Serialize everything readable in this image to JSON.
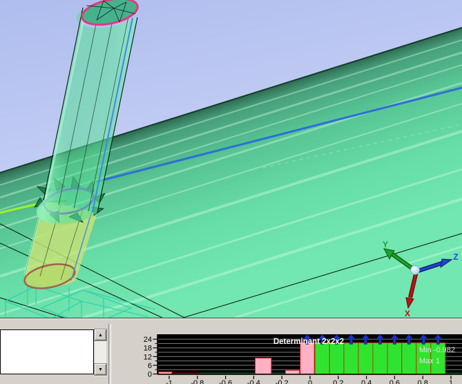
{
  "viewport": {
    "description": "3D mesh view: translucent green cylinder intersecting a large green plate",
    "axis_triad": {
      "x_label": "X",
      "y_label": "Y",
      "z_label": "Z",
      "x_color": "#b41414",
      "y_color": "#12a832",
      "z_color": "#2244ee"
    },
    "colors": {
      "sky_top": "#aebdee",
      "sky_bottom": "#dde2fa",
      "plane_near_horizon": "#2e6b50",
      "plane_front": "#72e7b1",
      "cylinder_body": "#55dd96",
      "cylinder_top_rim": "#dd3d78",
      "intersection_ring": "#7a3bd8",
      "below_plane_body": "#c8e276",
      "bottom_rim": "#a5604a",
      "scene_blue_line": "#2b6fd9",
      "ray_line": "#9ff32b",
      "hidden_wire": "#2ed0ad"
    }
  },
  "bottom_panel": {
    "listbox": {
      "items": []
    },
    "scrollbar": {
      "up_icon": "▲",
      "down_icon": "▼"
    }
  },
  "chart_data": {
    "type": "bar",
    "title": "Determinant 2x2x2",
    "min_label": "Min -0.982",
    "max_label": "Max 1",
    "min_value": -0.982,
    "max_value": 1,
    "xlim": [
      -1.08,
      1.08
    ],
    "ylim": [
      0,
      24
    ],
    "grid": true,
    "clip_at": 21.5,
    "clip_note": "bars taller than axis max are clipped and capped with a blue up-arrow",
    "arrow_color": "#2030cc",
    "yticks": [
      {
        "v": 0,
        "label": "0"
      },
      {
        "v": 6,
        "label": "6"
      },
      {
        "v": 12,
        "label": "12"
      },
      {
        "v": 18,
        "label": "18"
      },
      {
        "v": 24,
        "label": "24"
      }
    ],
    "yticks_minor": [
      3,
      9,
      15,
      21
    ],
    "grid_yvalues": [
      3,
      6,
      9,
      12,
      15,
      18,
      21,
      24
    ],
    "xticks": [
      {
        "v": -1,
        "label": "-1"
      },
      {
        "v": -0.8,
        "label": "-0.8"
      },
      {
        "v": -0.6,
        "label": "-0.6"
      },
      {
        "v": -0.4,
        "label": "-0.4"
      },
      {
        "v": -0.2,
        "label": "-0.2"
      },
      {
        "v": 0,
        "label": "0"
      },
      {
        "v": 0.2,
        "label": "0.2"
      },
      {
        "v": 0.4,
        "label": "0.4"
      },
      {
        "v": 0.6,
        "label": "0.6"
      },
      {
        "v": 0.8,
        "label": "0.8"
      },
      {
        "v": 1,
        "label": "1"
      }
    ],
    "colors": {
      "pink": {
        "fill": "#ffb0c4",
        "stroke": "#d01818"
      },
      "darkred": {
        "fill": "#8e1005",
        "stroke": "#6e0c04"
      },
      "green": {
        "fill": "#2fe42f",
        "stroke": "#b63c00"
      }
    },
    "bins": [
      {
        "from": -1.075,
        "to": -0.98,
        "count": 1.5,
        "color": "pink"
      },
      {
        "from": -0.98,
        "to": -0.785,
        "count": 0.7,
        "color": "darkred"
      },
      {
        "from": -0.39,
        "to": -0.275,
        "count": 11,
        "color": "pink"
      },
      {
        "from": -0.175,
        "to": -0.075,
        "count": 2.5,
        "color": "pink"
      },
      {
        "from": -0.07,
        "to": 0.03,
        "count": 25,
        "color": "pink"
      },
      {
        "from": 0.035,
        "to": 0.138,
        "count": 25,
        "color": "green"
      },
      {
        "from": 0.138,
        "to": 0.24,
        "count": 25,
        "color": "green"
      },
      {
        "from": 0.24,
        "to": 0.343,
        "count": 25,
        "color": "green"
      },
      {
        "from": 0.343,
        "to": 0.446,
        "count": 25,
        "color": "green"
      },
      {
        "from": 0.446,
        "to": 0.549,
        "count": 25,
        "color": "green"
      },
      {
        "from": 0.549,
        "to": 0.651,
        "count": 25,
        "color": "green"
      },
      {
        "from": 0.651,
        "to": 0.754,
        "count": 25,
        "color": "green"
      },
      {
        "from": 0.754,
        "to": 0.857,
        "count": 25,
        "color": "green"
      },
      {
        "from": 0.857,
        "to": 0.96,
        "count": 25,
        "color": "green"
      }
    ]
  }
}
